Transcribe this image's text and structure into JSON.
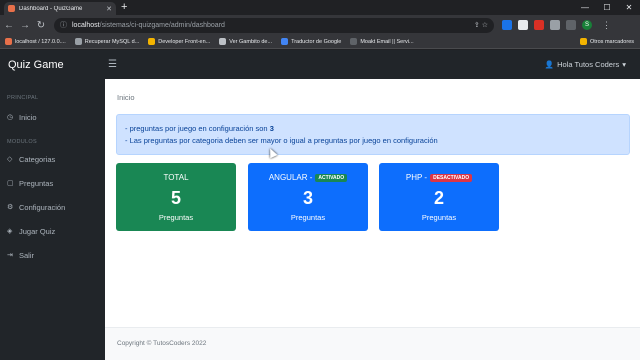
{
  "browser": {
    "tab_title": "Dashboard - QuizGame",
    "url_host": "localhost",
    "url_path": "/sistemas/ci-quizgame/admin/dashboard",
    "profile_initial": "S",
    "bookmarks": [
      {
        "label": "localhost / 127.0.0....",
        "color": "#e8704a"
      },
      {
        "label": "Recuperar MySQL d...",
        "color": "#9aa0a6"
      },
      {
        "label": "Developer Front-en...",
        "color": "#f4b400"
      },
      {
        "label": "Ver Gambito de...",
        "color": "#bdc1c6"
      },
      {
        "label": "Traductor de Google",
        "color": "#4285f4"
      },
      {
        "label": "Moakt Email || Servi...",
        "color": "#5f6368"
      }
    ],
    "other_bookmarks": "Otros marcadores"
  },
  "app": {
    "brand": "Quiz Game",
    "user_label": "Hola Tutos Coders"
  },
  "sidebar": {
    "section_principal": "PRINCIPAL",
    "section_modulos": "MODULOS",
    "items": [
      {
        "label": "Inicio",
        "icon": "gauge-icon"
      },
      {
        "label": "Categorias",
        "icon": "tags-icon"
      },
      {
        "label": "Preguntas",
        "icon": "question-icon"
      },
      {
        "label": "Configuración",
        "icon": "gear-icon"
      },
      {
        "label": "Jugar Quiz",
        "icon": "gamepad-icon"
      },
      {
        "label": "Salir",
        "icon": "logout-icon"
      }
    ]
  },
  "main": {
    "breadcrumb": "Inicio",
    "alert": {
      "line1_prefix": "- preguntas por juego en configuración son ",
      "line1_value": "3",
      "line2": "- Las preguntas por categoria deben ser mayor o igual a preguntas por juego en configuración"
    },
    "cards": [
      {
        "title": "TOTAL",
        "badge": "",
        "value": "5",
        "label": "Preguntas",
        "color": "#198754"
      },
      {
        "title": "ANGULAR -",
        "badge": "ACTIVADO",
        "value": "3",
        "label": "Preguntas",
        "color": "#0d6efd"
      },
      {
        "title": "PHP -",
        "badge": "DESACTIVADO",
        "value": "2",
        "label": "Preguntas",
        "color": "#0d6efd"
      }
    ]
  },
  "footer": {
    "copyright": "Copyright © TutosCoders 2022"
  }
}
